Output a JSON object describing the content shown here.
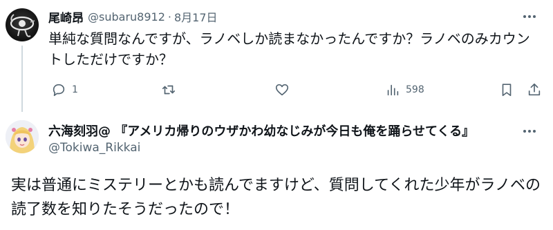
{
  "tweet1": {
    "name": "尾崎昂",
    "handle": "@subaru8912",
    "separator": "·",
    "date": "8月17日",
    "text": "単純な質問なんですが、ラノベしか読まなかったんですか？ラノベのみカウントしただけですか？",
    "actions": {
      "reply_count": "1",
      "views_count": "598"
    }
  },
  "tweet2": {
    "name": "六海刻羽@ 『アメリカ帰りのウザかわ幼なじみが今日も俺を踊らせてくる』",
    "handle": "@Tokiwa_Rikkai",
    "text": "実は普通にミステリーとかも読んでますけど、質問してくれた少年がラノベの読了数を知りたそうだったので！"
  },
  "icons": {
    "reply": "reply-icon",
    "retweet": "retweet-icon",
    "like": "heart-icon",
    "views": "views-icon",
    "bookmark": "bookmark-icon",
    "share": "share-icon",
    "more": "more-icon"
  },
  "colors": {
    "text": "#0f1419",
    "secondary": "#536471",
    "thread_line": "#cfd9de"
  }
}
